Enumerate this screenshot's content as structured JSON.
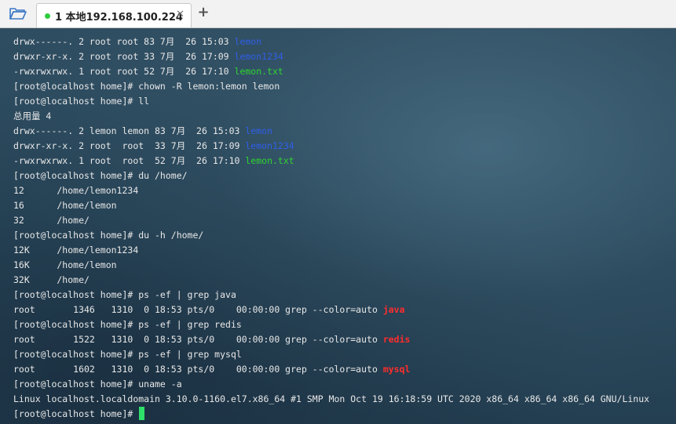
{
  "colors": {
    "tab_status_dot": "#2ecc40",
    "directory_text": "#2f5fe8",
    "file_text": "#2fd42f",
    "grep_match": "#ff2d2d",
    "cursor": "#2ee06a",
    "folder_icon": "#3b78c4"
  },
  "tabbar": {
    "folder_icon": "folder-open-icon",
    "tab": {
      "label": "1 本地192.168.100.224",
      "close_glyph": "✕"
    },
    "new_tab_glyph": "+"
  },
  "terminal": {
    "lines": [
      {
        "text": "drwx------. 2 root root 83 7月  26 15:03 ",
        "hl": "lemon",
        "kind": "dir"
      },
      {
        "text": "drwxr-xr-x. 2 root root 33 7月  26 17:09 ",
        "hl": "lemon1234",
        "kind": "dir"
      },
      {
        "text": "-rwxrwxrwx. 1 root root 52 7月  26 17:10 ",
        "hl": "lemon.txt",
        "kind": "file"
      },
      {
        "text": "[root@localhost home]# chown -R lemon:lemon lemon",
        "hl": "",
        "kind": ""
      },
      {
        "text": "[root@localhost home]# ll",
        "hl": "",
        "kind": ""
      },
      {
        "text": "总用量 4",
        "hl": "",
        "kind": ""
      },
      {
        "text": "drwx------. 2 lemon lemon 83 7月  26 15:03 ",
        "hl": "lemon",
        "kind": "dir"
      },
      {
        "text": "drwxr-xr-x. 2 root  root  33 7月  26 17:09 ",
        "hl": "lemon1234",
        "kind": "dir"
      },
      {
        "text": "-rwxrwxrwx. 1 root  root  52 7月  26 17:10 ",
        "hl": "lemon.txt",
        "kind": "file"
      },
      {
        "text": "[root@localhost home]# du /home/",
        "hl": "",
        "kind": ""
      },
      {
        "text": "12      /home/lemon1234",
        "hl": "",
        "kind": ""
      },
      {
        "text": "16      /home/lemon",
        "hl": "",
        "kind": ""
      },
      {
        "text": "32      /home/",
        "hl": "",
        "kind": ""
      },
      {
        "text": "[root@localhost home]# du -h /home/",
        "hl": "",
        "kind": ""
      },
      {
        "text": "12K     /home/lemon1234",
        "hl": "",
        "kind": ""
      },
      {
        "text": "16K     /home/lemon",
        "hl": "",
        "kind": ""
      },
      {
        "text": "32K     /home/",
        "hl": "",
        "kind": ""
      },
      {
        "text": "[root@localhost home]# ps -ef | grep java",
        "hl": "",
        "kind": ""
      },
      {
        "text": "root       1346   1310  0 18:53 pts/0    00:00:00 grep --color=auto ",
        "hl": "java",
        "kind": "match"
      },
      {
        "text": "[root@localhost home]# ps -ef | grep redis",
        "hl": "",
        "kind": ""
      },
      {
        "text": "root       1522   1310  0 18:53 pts/0    00:00:00 grep --color=auto ",
        "hl": "redis",
        "kind": "match"
      },
      {
        "text": "[root@localhost home]# ps -ef | grep mysql",
        "hl": "",
        "kind": ""
      },
      {
        "text": "root       1602   1310  0 18:53 pts/0    00:00:00 grep --color=auto ",
        "hl": "mysql",
        "kind": "match"
      },
      {
        "text": "[root@localhost home]# uname -a",
        "hl": "",
        "kind": ""
      },
      {
        "text": "Linux localhost.localdomain 3.10.0-1160.el7.x86_64 #1 SMP Mon Oct 19 16:18:59 UTC 2020 x86_64 x86_64 x86_64 GNU/Linux",
        "hl": "",
        "kind": ""
      },
      {
        "text": "[root@localhost home]# ",
        "hl": "",
        "kind": "",
        "cursor": true
      }
    ]
  }
}
